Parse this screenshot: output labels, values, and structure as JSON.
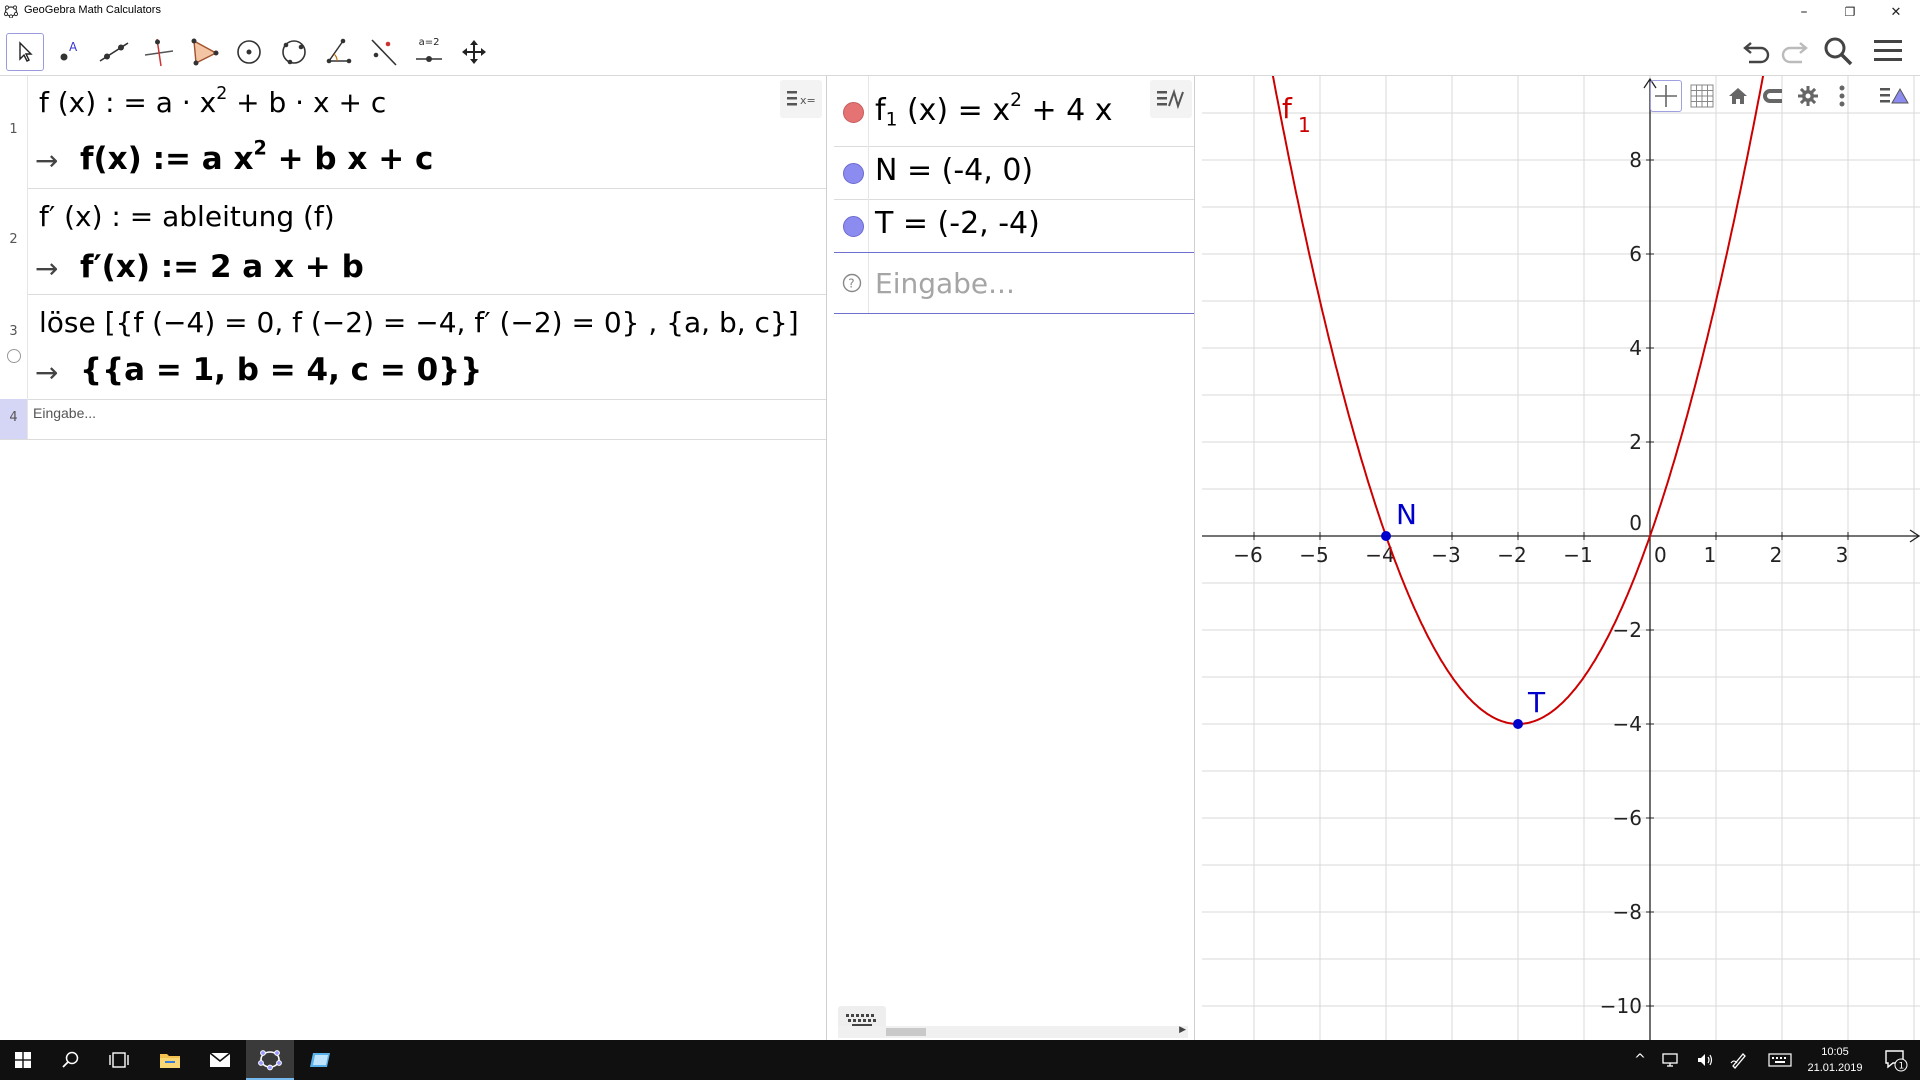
{
  "window": {
    "title": "GeoGebra Math Calculators",
    "minimize_label": "–",
    "restore_label": "❐",
    "close_label": "✕"
  },
  "toolbar": {
    "tools": [
      "move-tool",
      "point-tool",
      "line-tool",
      "perpendicular-line-tool",
      "polygon-tool",
      "circle-tool",
      "ellipse-tool",
      "angle-tool",
      "reflect-tool",
      "slider-tool",
      "move-view-tool"
    ],
    "slider_tool_label": "a=2",
    "right_tools": [
      "undo",
      "redo",
      "search",
      "menu"
    ]
  },
  "cas": {
    "rows": [
      {
        "number": "1",
        "input_lhs": "f (x) : =  a · x",
        "input_exp": "2",
        "input_rhs": " + b · x + c",
        "output_lhs": "f(x)  :=  a x",
        "output_exp": "2",
        "output_rhs": " + b x + c"
      },
      {
        "number": "2",
        "input": "f′ (x) : =  ableitung (f)",
        "output": "f′(x)  :=  2 a x + b"
      },
      {
        "number": "3",
        "input": "löse [{f (−4)  =  0, f (−2)  =  −4, f′ (−2)  =  0} , {a, b, c}]",
        "output": "{{a = 1, b = 4, c = 0}}"
      },
      {
        "number": "4",
        "placeholder": "Eingabe..."
      }
    ]
  },
  "algebra": {
    "items": [
      {
        "name": "f",
        "subscript": "1",
        "text_a": " (x)  =  x",
        "exp": "2",
        "text_b": " + 4 x",
        "color": "#e57373"
      },
      {
        "text": "N  =  (-4,  0)",
        "color": "#8c8cf0"
      },
      {
        "text": "T  =  (-2,  -4)",
        "color": "#8c8cf0"
      }
    ],
    "input_placeholder": "Eingabe..."
  },
  "graphics": {
    "x_ticks": [
      -6,
      -5,
      -4,
      -3,
      -2,
      -1,
      0,
      1,
      2,
      3
    ],
    "x_labels": [
      "−6",
      "−5",
      "−4",
      "−3",
      "−2",
      "−1",
      "0",
      "1",
      "2",
      "3"
    ],
    "y_ticks": [
      8,
      6,
      4,
      2,
      0,
      -2,
      -4,
      -6,
      -8,
      -10
    ],
    "y_labels": [
      "8",
      "6",
      "4",
      "2",
      "0",
      "−2",
      "−4",
      "−6",
      "−8",
      "−10"
    ],
    "function": {
      "label": "f",
      "subscript": "1",
      "a": 1,
      "b": 4,
      "c": 0,
      "color": "#cc0000"
    },
    "points": [
      {
        "label": "N",
        "x": -4,
        "y": 0,
        "color": "#0000cc"
      },
      {
        "label": "T",
        "x": -2,
        "y": -4,
        "color": "#0000cc"
      }
    ]
  },
  "taskbar": {
    "time": "10:05",
    "date": "21.01.2019",
    "notification_count": "1"
  }
}
